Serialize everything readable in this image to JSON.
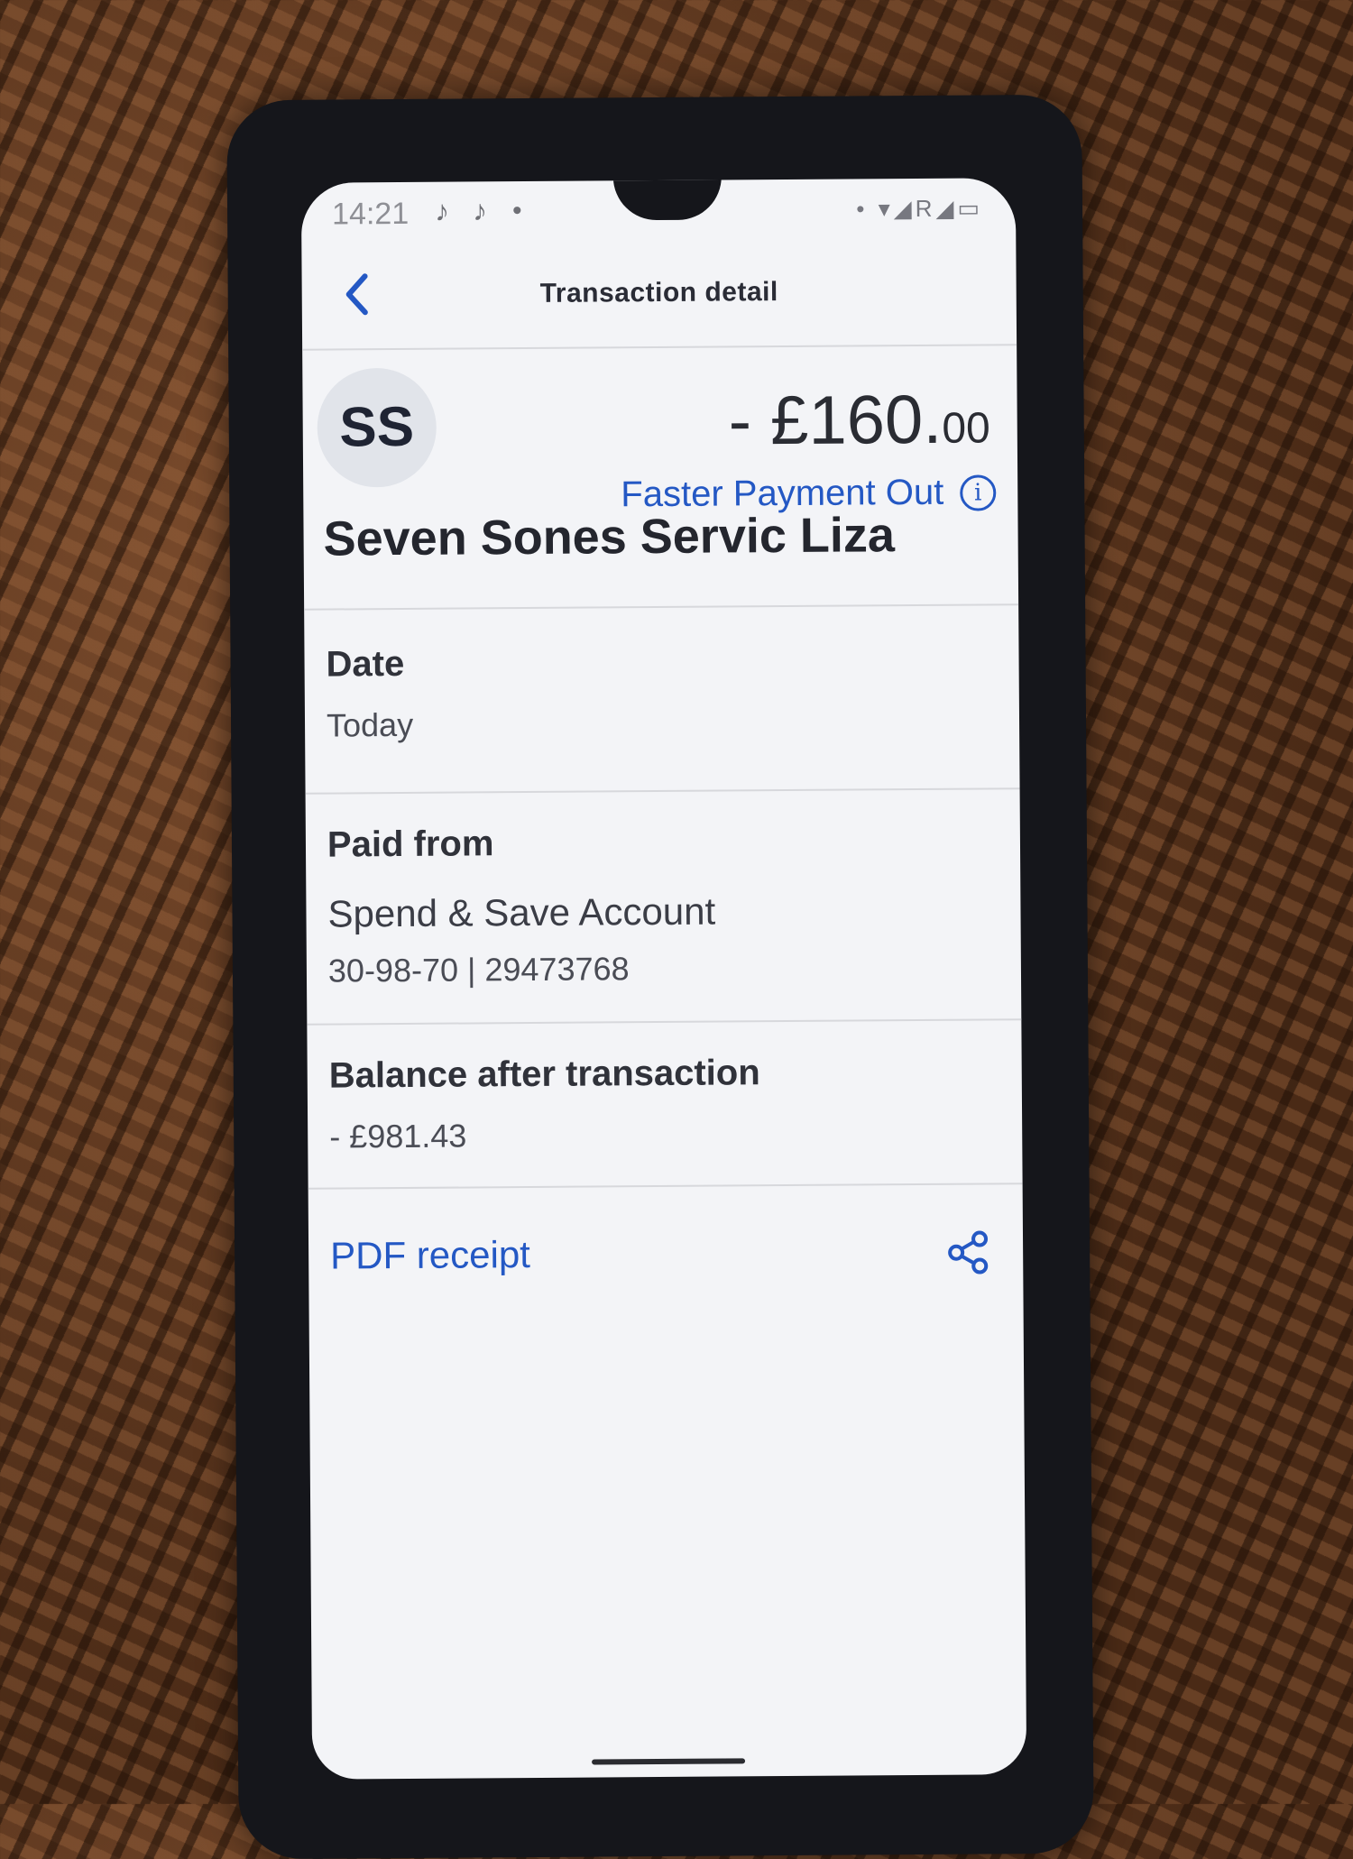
{
  "status_bar": {
    "time": "14:21",
    "app_icons": [
      "tiktok-icon",
      "tiktok-icon"
    ],
    "right_glyphs": "• ▾◢R◢▭"
  },
  "header": {
    "title": "Transaction detail",
    "back_icon": "chevron-left-icon"
  },
  "transaction": {
    "avatar_initials": "SS",
    "amount_main": "- £160.",
    "amount_minor": "00",
    "payment_type": "Faster Payment Out",
    "payee_name": "Seven Sones Servic Liza"
  },
  "details": {
    "date_label": "Date",
    "date_value": "Today",
    "paid_from_label": "Paid from",
    "account_name": "Spend & Save Account",
    "account_numbers": "30-98-70 | 29473768",
    "balance_label": "Balance after transaction",
    "balance_value": "- £981.43"
  },
  "receipt": {
    "label": "PDF receipt",
    "share_icon": "share-icon"
  },
  "colors": {
    "accent": "#2458c4",
    "screen_bg": "#f3f4f7",
    "text_primary": "#24262e"
  }
}
